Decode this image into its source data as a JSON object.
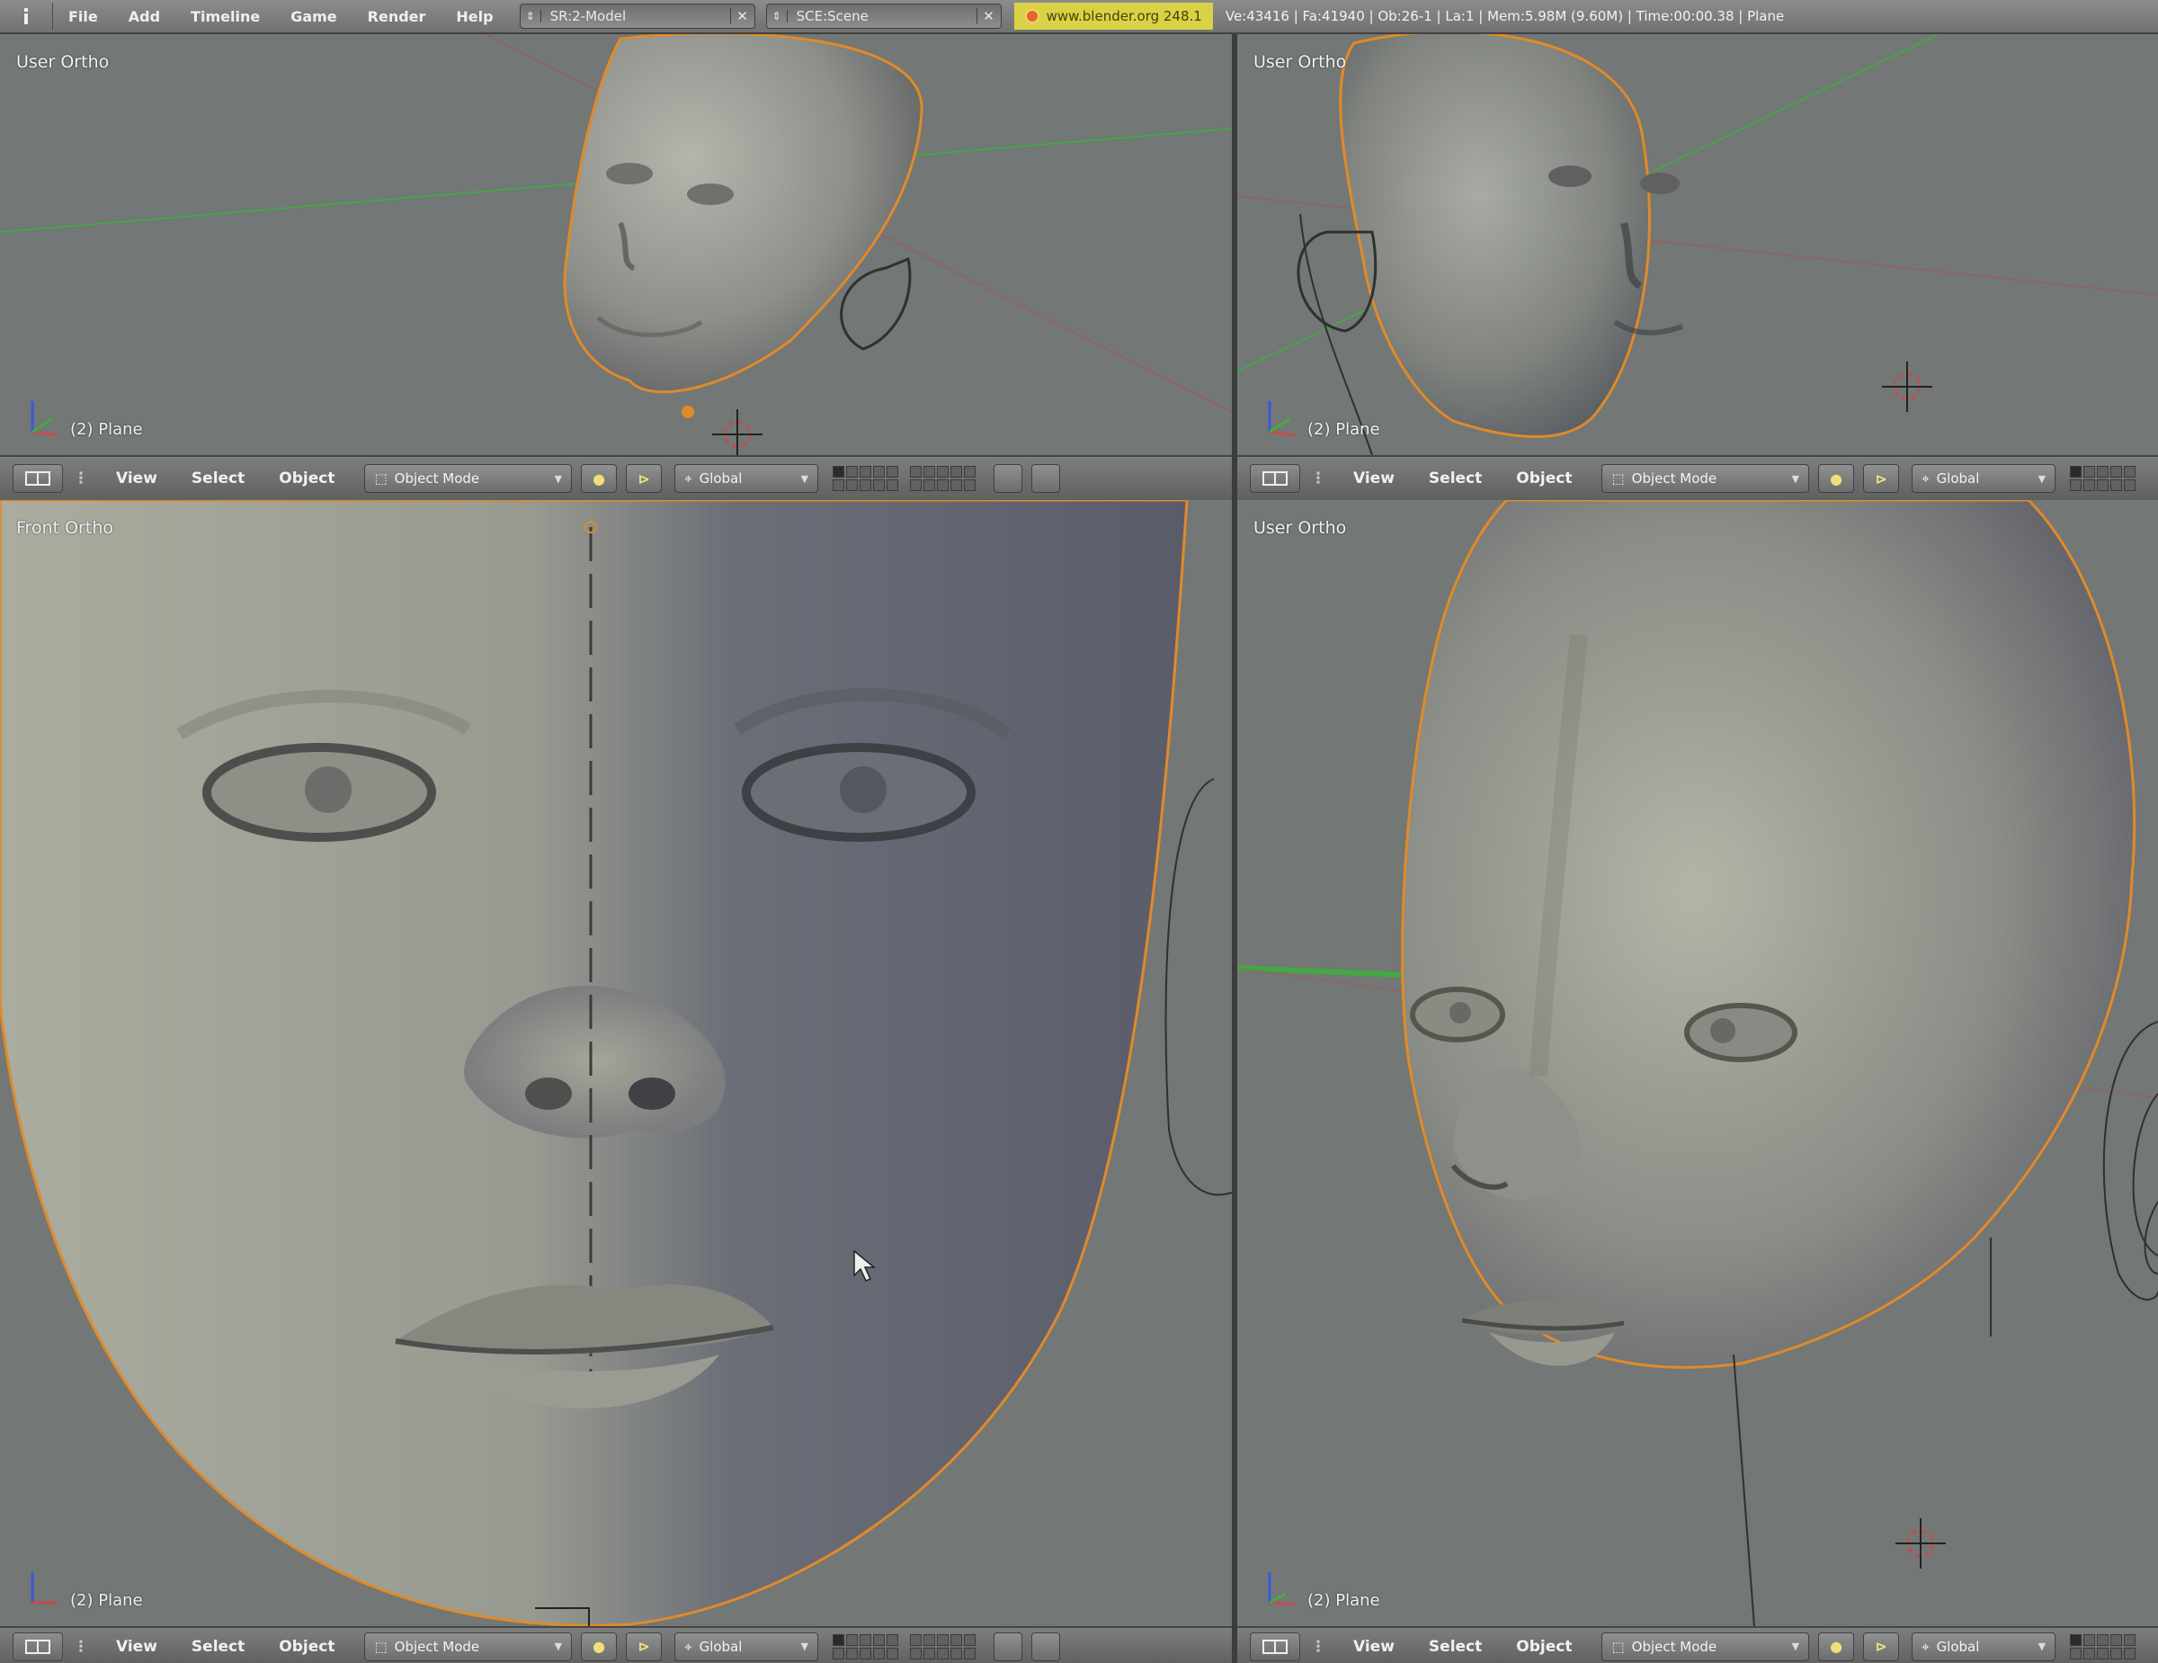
{
  "topbar": {
    "editor_icon": "info-editor-icon",
    "menus": [
      "File",
      "Add",
      "Timeline",
      "Game",
      "Render",
      "Help"
    ],
    "screen": "SR:2-Model",
    "scene": "SCE:Scene",
    "url": "www.blender.org 248.1",
    "stats": "Ve:43416 | Fa:41940 | Ob:26-1 | La:1 | Mem:5.98M (9.60M) | Time:00:00.38 | Plane"
  },
  "viewports": {
    "top_left": {
      "view_name": "User Ortho",
      "object_label": "(2) Plane"
    },
    "top_right": {
      "view_name": "User Ortho",
      "object_label": "(2) Plane"
    },
    "bottom_left": {
      "view_name": "Front Ortho",
      "object_label": "(2) Plane"
    },
    "bottom_right": {
      "view_name": "User Ortho",
      "object_label": "(2) Plane"
    }
  },
  "header": {
    "menus": [
      "View",
      "Select",
      "Object"
    ],
    "mode": "Object Mode",
    "orientation": "Global",
    "pivot_icon": "pivot-point-icon",
    "snap_icon": "magnet-icon"
  },
  "colors": {
    "background": "#737775",
    "selection_outline": "#e08a2a",
    "x_axis": "#c24d4d",
    "y_axis": "#3fae3f",
    "z_axis": "#3a5ad8"
  }
}
